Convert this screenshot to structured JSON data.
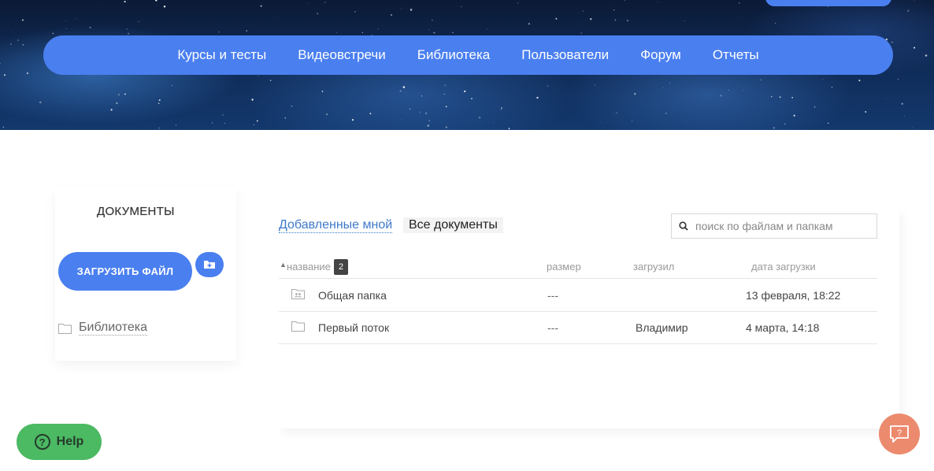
{
  "nav": {
    "items": [
      "Курсы и тесты",
      "Видеовстречи",
      "Библиотека",
      "Пользователи",
      "Форум",
      "Отчеты"
    ]
  },
  "sidebar": {
    "title": "ДОКУМЕНТЫ",
    "upload_label": "ЗАГРУЗИТЬ ФАЙЛ",
    "tree": [
      {
        "label": "Библиотека",
        "icon": "folder-icon"
      }
    ]
  },
  "main": {
    "tabs": [
      {
        "label": "Добавленные мной",
        "active": false
      },
      {
        "label": "Все документы",
        "active": true
      }
    ],
    "search": {
      "placeholder": "поиск по файлам и папкам",
      "value": ""
    },
    "table": {
      "headers": {
        "name": "название",
        "size": "размер",
        "uploader": "загрузил",
        "date": "дата загрузки"
      },
      "count": "2",
      "rows": [
        {
          "name": "Общая папка",
          "size": "---",
          "uploader": "",
          "date": "13 февраля, 18:22",
          "icon": "shared-folder-icon"
        },
        {
          "name": "Первый поток",
          "size": "---",
          "uploader": "Владимир",
          "date": "4 марта, 14:18",
          "icon": "folder-icon"
        }
      ]
    }
  },
  "widgets": {
    "help_label": "Help"
  },
  "colors": {
    "accent": "#4a7ff0",
    "help": "#4cb963",
    "chat": "#ec8a6e",
    "link": "#3f79c9"
  }
}
